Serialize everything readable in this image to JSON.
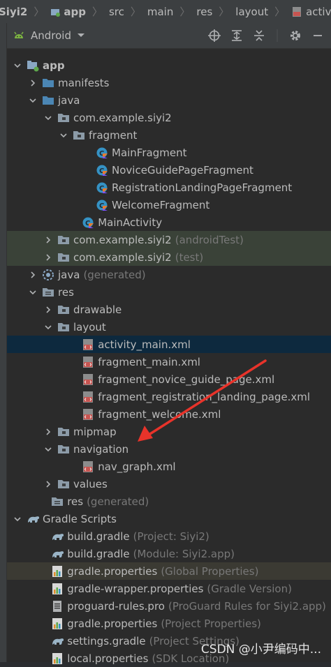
{
  "breadcrumb": [
    "Siyi2",
    "app",
    "src",
    "main",
    "res",
    "layout",
    "activity_main.xml"
  ],
  "panel": {
    "view_mode": "Android"
  },
  "tree": [
    {
      "label": "app",
      "secondary": "",
      "bold": true
    },
    {
      "label": "manifests",
      "secondary": ""
    },
    {
      "label": "java",
      "secondary": ""
    },
    {
      "label": "com.example.siyi2",
      "secondary": ""
    },
    {
      "label": "fragment",
      "secondary": ""
    },
    {
      "label": "MainFragment",
      "secondary": ""
    },
    {
      "label": "NoviceGuidePageFragment",
      "secondary": ""
    },
    {
      "label": "RegistrationLandingPageFragment",
      "secondary": ""
    },
    {
      "label": "WelcomeFragment",
      "secondary": ""
    },
    {
      "label": "MainActivity",
      "secondary": ""
    },
    {
      "label": "com.example.siyi2",
      "secondary": "(androidTest)"
    },
    {
      "label": "com.example.siyi2",
      "secondary": "(test)"
    },
    {
      "label": "java",
      "secondary": "(generated)"
    },
    {
      "label": "res",
      "secondary": ""
    },
    {
      "label": "drawable",
      "secondary": ""
    },
    {
      "label": "layout",
      "secondary": ""
    },
    {
      "label": "activity_main.xml",
      "secondary": ""
    },
    {
      "label": "fragment_main.xml",
      "secondary": ""
    },
    {
      "label": "fragment_novice_guide_page.xml",
      "secondary": ""
    },
    {
      "label": "fragment_registration_landing_page.xml",
      "secondary": ""
    },
    {
      "label": "fragment_welcome.xml",
      "secondary": ""
    },
    {
      "label": "mipmap",
      "secondary": ""
    },
    {
      "label": "navigation",
      "secondary": ""
    },
    {
      "label": "nav_graph.xml",
      "secondary": ""
    },
    {
      "label": "values",
      "secondary": ""
    },
    {
      "label": "res",
      "secondary": "(generated)"
    },
    {
      "label": "Gradle Scripts",
      "secondary": ""
    },
    {
      "label": "build.gradle",
      "secondary": "(Project: Siyi2)"
    },
    {
      "label": "build.gradle",
      "secondary": "(Module: Siyi2.app)"
    },
    {
      "label": "gradle.properties",
      "secondary": "(Global Properties)"
    },
    {
      "label": "gradle-wrapper.properties",
      "secondary": "(Gradle Version)"
    },
    {
      "label": "proguard-rules.pro",
      "secondary": "(ProGuard Rules for Siyi2.app)"
    },
    {
      "label": "gradle.properties",
      "secondary": "(Project Properties)"
    },
    {
      "label": "settings.gradle",
      "secondary": "(Project Settings)"
    },
    {
      "label": "local.properties",
      "secondary": "(SDK Location)"
    }
  ],
  "watermark": "CSDN @小尹编码中...",
  "colors": {
    "background": "#2b2b2b",
    "selected_row": "#0d293e",
    "test_row": "#3a4238",
    "properties_row": "#3b3a33",
    "annotation_arrow": "#e8332a"
  }
}
